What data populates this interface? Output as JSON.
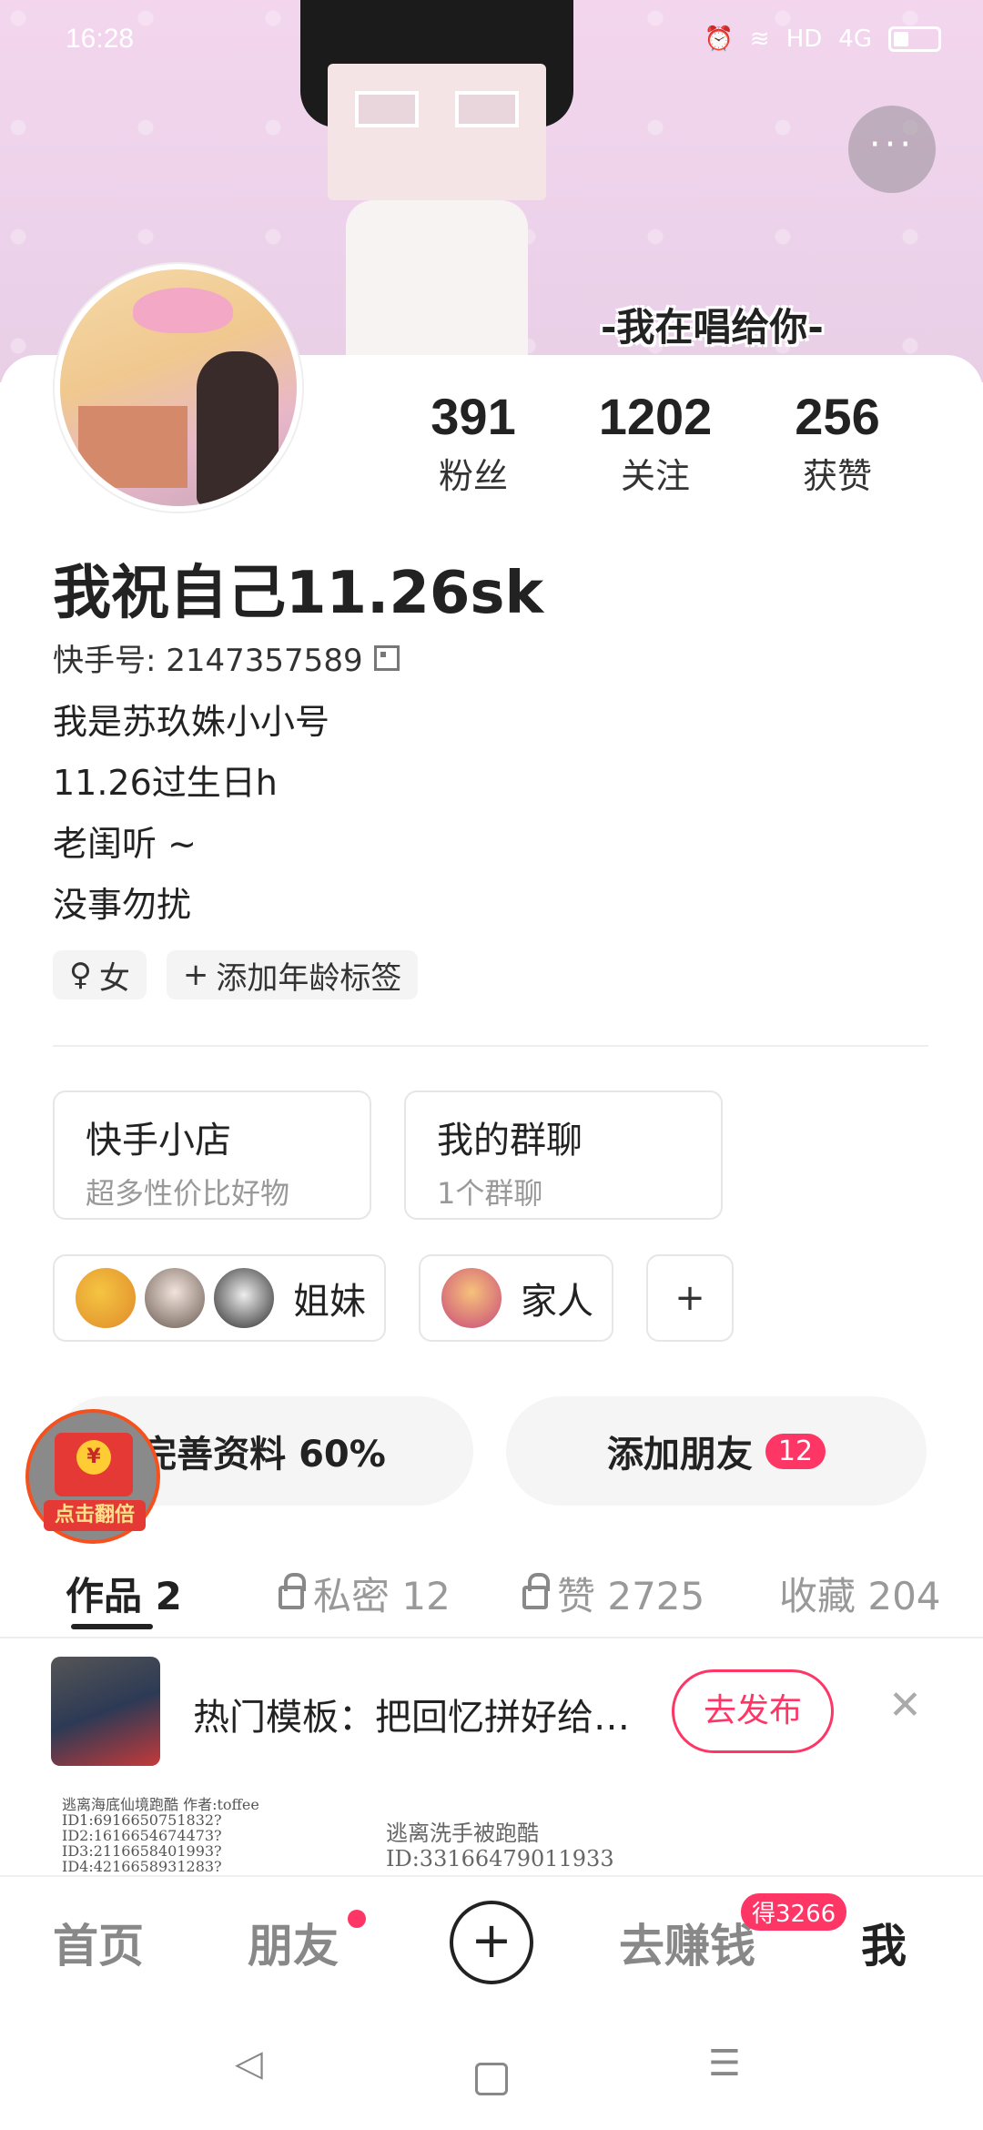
{
  "status_bar": {
    "time": "16:28",
    "icons": [
      "alarm-icon",
      "wifi-icon",
      "hd-icon",
      "signal-icon",
      "battery-icon"
    ],
    "signal_label": "4G",
    "hd_label": "HD"
  },
  "banner": {
    "caption": "-我在唱给你-",
    "more_label": "···"
  },
  "profile": {
    "name": "我祝自己11.26sk",
    "kuaishou_id_label": "快手号: 2147357589",
    "bio_lines": [
      "我是苏玖姝小小号",
      "11.26过生日h",
      "老闺听 ~",
      "没事勿扰"
    ],
    "stats": [
      {
        "value": "391",
        "label": "粉丝"
      },
      {
        "value": "1202",
        "label": "关注"
      },
      {
        "value": "256",
        "label": "获赞"
      }
    ],
    "tags": [
      {
        "icon": "female-icon",
        "label": "女"
      },
      {
        "icon": "plus-icon",
        "label": "添加年龄标签"
      }
    ]
  },
  "cards": [
    {
      "title": "快手小店",
      "subtitle": "超多性价比好物"
    },
    {
      "title": "我的群聊",
      "subtitle": "1个群聊"
    }
  ],
  "groups": [
    {
      "label": "姐妹"
    },
    {
      "label": "家人"
    },
    {
      "label": "+"
    }
  ],
  "actions": {
    "complete_profile": "完善资料 60%",
    "complete_progress": 0.6,
    "add_friends": "添加朋友",
    "add_friends_badge": "12"
  },
  "red_packet": {
    "coin": "¥",
    "label": "点击翻倍"
  },
  "tabs": [
    {
      "label": "作品 2",
      "active": true
    },
    {
      "label": "私密 12",
      "locked": true
    },
    {
      "label": "赞 2725",
      "locked": true
    },
    {
      "label": "收藏 204"
    }
  ],
  "template_bar": {
    "text": "热门模板：把回忆拼好给…",
    "button": "去发布",
    "close": "✕"
  },
  "watermark": {
    "left_lines": [
      "逃离海底仙境跑酷 作者:toffee",
      "ID1:6916650751832?",
      "ID2:1616654674473?",
      "ID3:2116658401993?",
      "ID4:4216658931283?"
    ],
    "center_lines": [
      "逃离洗手被跑酷",
      "ID:33166479011933"
    ]
  },
  "bottom_nav": {
    "home": "首页",
    "friends": "朋友",
    "publish": "+",
    "earn": "去赚钱",
    "earn_badge": "得3266",
    "me": "我"
  },
  "system_nav": {
    "back": "◁",
    "home": "□",
    "menu": "☰"
  },
  "colors": {
    "accent": "#fe3666",
    "banner_bg": "#ecd2ea",
    "sheet_bg": "#ffffff"
  }
}
